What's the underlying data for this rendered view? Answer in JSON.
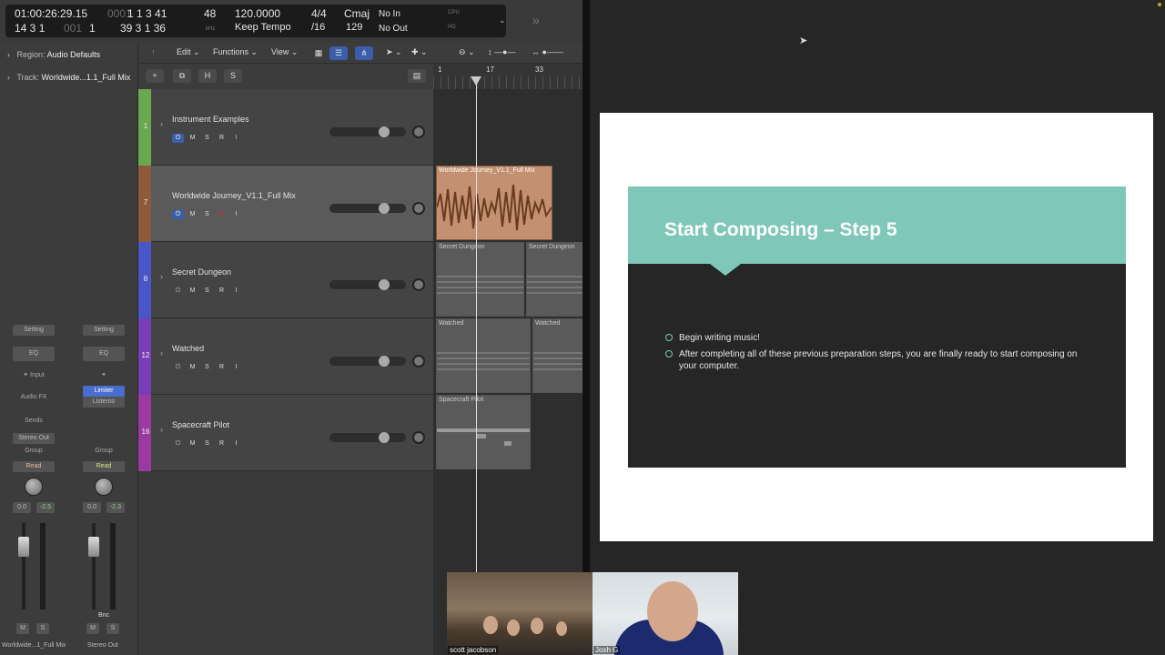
{
  "lcd": {
    "time": "01:00:26:29.15",
    "bars_top": "1  1  3  41",
    "time_dim": "0001",
    "bars_bottom_a": "14 3 1",
    "bars_bottom_dim": "001",
    "bars_bottom_b": "1",
    "bars_bottom_c": "39 3 1 36",
    "khz": "48",
    "khz_unit": "kHz",
    "tempo": "120.0000",
    "tempo_mode": "Keep Tempo",
    "signature": "4/4",
    "division": "/16",
    "key": "Cmaj",
    "key_value": "129",
    "in_label": "No In",
    "out_label": "No Out",
    "cpu": "CPU",
    "hd": "HD"
  },
  "inspector": {
    "region_label": "Region:",
    "region_value": "Audio Defaults",
    "track_label": "Track:",
    "track_value": "Worldwide...1.1_Full Mix",
    "strip1": {
      "setting": "Setting",
      "eq": "EQ",
      "input": "Input",
      "audio_fx": "Audio FX",
      "sends": "Sends",
      "output": "Stereo Out",
      "group": "Group",
      "automation": "Read",
      "vol": "0.0",
      "peak": "-2.5",
      "m": "M",
      "s": "S",
      "name": "Worldwide...1_Full Mix"
    },
    "strip2": {
      "setting": "Setting",
      "eq": "EQ",
      "limiter": "Limiter",
      "listento": "Listento",
      "group": "Group",
      "automation": "Read",
      "vol": "0.0",
      "peak": "-2.3",
      "bnc": "Bnc",
      "m": "M",
      "s": "S",
      "name": "Stereo Out"
    }
  },
  "toolbar": {
    "edit": "Edit",
    "functions": "Functions",
    "view": "View",
    "add": "+",
    "h": "H",
    "s": "S"
  },
  "ruler": {
    "marks": [
      "1",
      "17",
      "33"
    ]
  },
  "tracks": [
    {
      "num": "1",
      "name": "Instrument Examples",
      "color": "#6aa84f"
    },
    {
      "num": "7",
      "name": "Worldwide Journey_V1.1_Full Mix",
      "color": "#8f5a3a"
    },
    {
      "num": "8",
      "name": "Secret Dungeon",
      "color": "#4a55c8"
    },
    {
      "num": "12",
      "name": "Watched",
      "color": "#7b3cb8"
    },
    {
      "num": "16",
      "name": "Spacecraft Pilot",
      "color": "#9b3aa0"
    }
  ],
  "track_buttons": {
    "m": "M",
    "s": "S",
    "r": "R",
    "i": "I"
  },
  "regions": {
    "worldwide": "Worldwide Journey_V1.1_Full Mix",
    "secret1": "Secret Dungeon",
    "secret2": "Secret Dungeon",
    "watched1": "Watched",
    "watched2": "Watched",
    "spacecraft": "Spacecraft Pilot"
  },
  "slide": {
    "title": "Start Composing – Step 5",
    "bullets": [
      "Begin writing music!",
      "After completing all of these previous preparation steps, you are finally ready to start composing on your computer."
    ]
  },
  "video": {
    "participant1": "scott jacobson",
    "participant2": "Josh G"
  },
  "colors": {
    "slide_band": "#7fc7b8",
    "slide_body": "#262626",
    "audio_region": "#c39071"
  }
}
